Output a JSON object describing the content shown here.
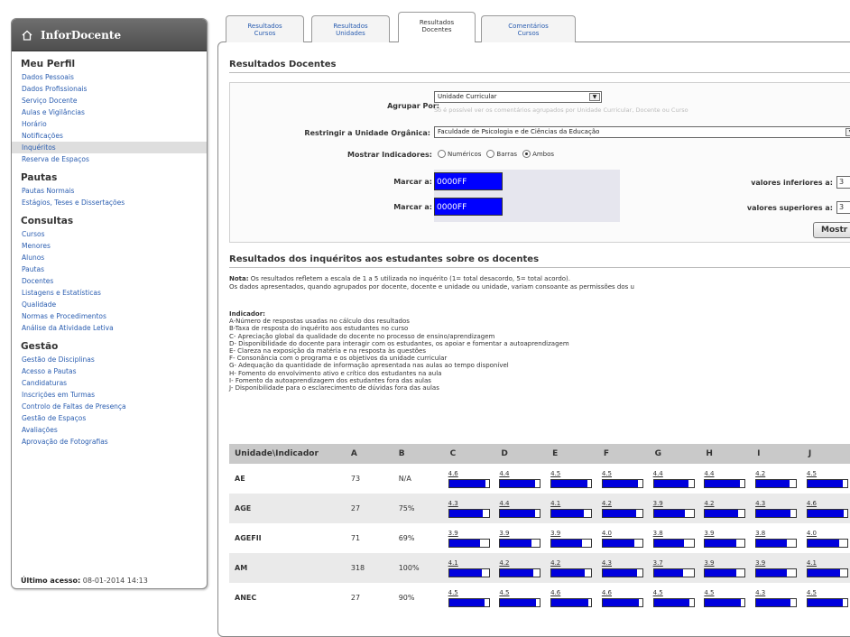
{
  "app": {
    "title": "InforDocente"
  },
  "sidebar": {
    "sections": [
      {
        "title": "Meu Perfil",
        "items": [
          "Dados Pessoais",
          "Dados Profissionais",
          "Serviço Docente",
          "Aulas e Vigilâncias",
          "Horário",
          "Notificações",
          "Inquéritos",
          "Reserva de Espaços"
        ]
      },
      {
        "title": "Pautas",
        "items": [
          "Pautas Normais",
          "Estágios, Teses e Dissertações"
        ]
      },
      {
        "title": "Consultas",
        "items": [
          "Cursos",
          "Menores",
          "Alunos",
          "Pautas",
          "Docentes",
          "Listagens e Estatísticas",
          "Qualidade",
          "Normas e Procedimentos",
          "Análise da Atividade Letiva"
        ]
      },
      {
        "title": "Gestão",
        "items": [
          "Gestão de Disciplinas",
          "Acesso a Pautas",
          "Candidaturas",
          "Inscrições em Turmas",
          "Controlo de Faltas de Presença",
          "Gestão de Espaços",
          "Avaliações",
          "Aprovação de Fotografias"
        ]
      }
    ],
    "active_item": "Inquéritos",
    "last_access_label": "Último acesso:",
    "last_access_value": "08-01-2014 14:13"
  },
  "tabs": [
    {
      "line1": "Resultados",
      "line2": "Cursos"
    },
    {
      "line1": "Resultados",
      "line2": "Unidades"
    },
    {
      "line1": "Resultados",
      "line2": "Docentes"
    },
    {
      "line1": "Comentários",
      "line2": "Cursos"
    }
  ],
  "active_tab": 2,
  "page": {
    "title": "Resultados Docentes"
  },
  "filters": {
    "group_by_label": "Agrupar Por:",
    "group_by_value": "Unidade Curricular",
    "group_by_hint": "Só é possível ver os comentários agrupados por Unidade Curricular, Docente ou Curso",
    "restrict_label": "Restringir a Unidade Orgânica:",
    "restrict_value": "Faculdade de Psicologia e de Ciências da Educação",
    "show_label": "Mostrar Indicadores:",
    "show_options": [
      "Numéricos",
      "Barras",
      "Ambos"
    ],
    "show_selected": "Ambos",
    "mark1_label": "Marcar a:",
    "mark1_color": "0000FF",
    "mark2_label": "Marcar a:",
    "mark2_color": "0000FF",
    "lower_label": "valores inferiores a:",
    "lower_value": "3",
    "upper_label": "valores superiores a:",
    "upper_value": "3",
    "show_button": "Mostr"
  },
  "results": {
    "title": "Resultados dos inquéritos aos estudantes sobre os docentes",
    "note_label": "Nota:",
    "note_line1": " Os resultados refletem a escala de 1 a 5 utilizada no inquérito (1= total desacordo, 5= total acordo).",
    "note_line2": "Os dados apresentados, quando agrupados por docente, docente e unidade ou unidade, variam consoante as permissões dos u",
    "indicator_title": "Indicador:",
    "indicators": [
      "A-Número de respostas usadas no cálculo dos resultados",
      "B-Taxa de resposta do inquérito aos estudantes no curso",
      "C- Apreciação global da qualidade do docente no processo de ensino/aprendizagem",
      "D- Disponibilidade do docente para interagir com os estudantes, os apoiar e fomentar a autoaprendizagem",
      "E- Clareza na exposição da matéria e na resposta às questões",
      "F- Consonância com o programa e os objetivos da unidade curricular",
      "G- Adequação da quantidade de informação apresentada nas aulas ao tempo disponível",
      "H- Fomento do envolvimento ativo e crítico dos estudantes na aula",
      "I- Fomento da autoaprendizagem dos estudantes fora das aulas",
      "J- Disponibilidade para o esclarecimento de dúvidas fora das aulas"
    ],
    "columns": [
      "Unidade\\Indicador",
      "A",
      "B",
      "C",
      "D",
      "E",
      "F",
      "G",
      "H",
      "I",
      "J"
    ],
    "rows": [
      {
        "unit": "AE",
        "a": "73",
        "b": "N/A",
        "scores": [
          4.6,
          4.4,
          4.5,
          4.5,
          4.4,
          4.4,
          4.2,
          4.5
        ]
      },
      {
        "unit": "AGE",
        "a": "27",
        "b": "75%",
        "scores": [
          4.3,
          4.4,
          4.1,
          4.2,
          3.9,
          4.2,
          4.3,
          4.6
        ]
      },
      {
        "unit": "AGEFII",
        "a": "71",
        "b": "69%",
        "scores": [
          3.9,
          3.9,
          3.9,
          4.0,
          3.8,
          3.9,
          3.8,
          4.0
        ]
      },
      {
        "unit": "AM",
        "a": "318",
        "b": "100%",
        "scores": [
          4.1,
          4.2,
          4.2,
          4.3,
          3.7,
          3.9,
          3.9,
          4.1
        ]
      },
      {
        "unit": "ANEC",
        "a": "27",
        "b": "90%",
        "scores": [
          4.5,
          4.5,
          4.6,
          4.6,
          4.5,
          4.5,
          4.3,
          4.5
        ]
      }
    ],
    "bar_color": "#0000dd",
    "scale_max": 5
  }
}
